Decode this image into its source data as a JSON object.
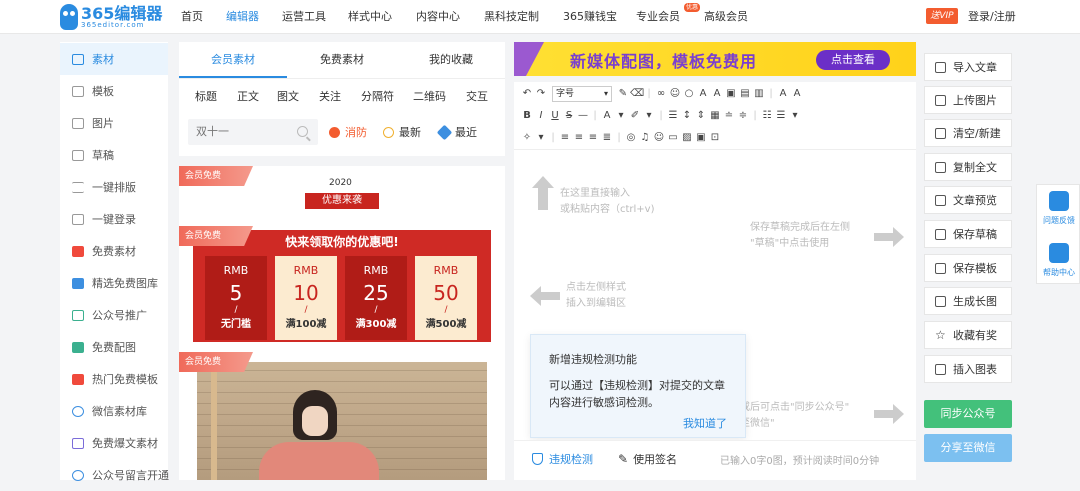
{
  "header": {
    "brand": "365编辑器",
    "domain": "365editor.com",
    "nav": [
      "首页",
      "编辑器",
      "运营工具",
      "样式中心",
      "内容中心",
      "黑科技定制",
      "365赚钱宝",
      "专业会员",
      "高级会员"
    ],
    "active_nav": "编辑器",
    "hot_badge": "优惠",
    "vip_badge": "送VIP",
    "login": "登录/注册"
  },
  "sidebar": {
    "items": [
      {
        "label": "素材",
        "icon": "folder-icon"
      },
      {
        "label": "模板",
        "icon": "template-icon"
      },
      {
        "label": "图片",
        "icon": "image-icon"
      },
      {
        "label": "草稿",
        "icon": "draft-icon"
      },
      {
        "label": "一键排版",
        "icon": "format-icon"
      },
      {
        "label": "一键登录",
        "icon": "login-icon"
      },
      {
        "label": "免费素材",
        "icon": "free-material-icon"
      },
      {
        "label": "精选免费图库",
        "icon": "gallery-icon"
      },
      {
        "label": "公众号推广",
        "icon": "book-icon"
      },
      {
        "label": "免费配图",
        "icon": "picture-icon"
      },
      {
        "label": "热门免费模板",
        "icon": "hot-template-icon"
      },
      {
        "label": "微信素材库",
        "icon": "wechat-library-icon"
      },
      {
        "label": "免费爆文素材",
        "icon": "article-icon"
      },
      {
        "label": "公众号留言开通",
        "icon": "comment-icon"
      }
    ]
  },
  "material_panel": {
    "tabs": [
      "会员素材",
      "免费素材",
      "我的收藏"
    ],
    "categories": [
      "标题",
      "正文",
      "图文",
      "关注",
      "分隔符",
      "二维码",
      "交互"
    ],
    "search_placeholder": "双十一",
    "filters": [
      "消防",
      "最新",
      "最近"
    ]
  },
  "material_list": {
    "badge": "会员免费",
    "card1": {
      "year": "2020",
      "title": "优惠来袭"
    },
    "card2": {
      "title": "快来领取你的优惠吧!",
      "coupons": [
        {
          "unit": "RMB",
          "value": "5",
          "slash": "/",
          "cond": "无门槛"
        },
        {
          "unit": "RMB",
          "value": "10",
          "slash": "/",
          "cond": "满100减"
        },
        {
          "unit": "RMB",
          "value": "25",
          "slash": "/",
          "cond": "满300减"
        },
        {
          "unit": "RMB",
          "value": "50",
          "slash": "/",
          "cond": "满500减"
        }
      ]
    }
  },
  "banner": {
    "text": "新媒体配图，模板免费用",
    "button": "点击查看"
  },
  "toolbar": {
    "font_select": "字号"
  },
  "editor": {
    "hint_input": "在这里直接输入\n或粘贴内容（ctrl+v)",
    "hint_style": "点击左侧样式\n插入到编辑区",
    "hint_draft": "保存草稿完成后在左侧\n\"草稿\"中点击使用",
    "hint_sync": "或后可点击\"同步公众号\"\n至微信\""
  },
  "popup": {
    "title": "新增违规检测功能",
    "body": "可以通过【违规检测】对提交的文章内容进行敏感词检测。",
    "button": "我知道了"
  },
  "footer": {
    "check": "违规检测",
    "signature": "使用签名",
    "status": "已输入0字0图，预计阅读时间0分钟"
  },
  "actions": {
    "items": [
      "导入文章",
      "上传图片",
      "清空/新建",
      "复制全文",
      "文章预览",
      "保存草稿",
      "保存模板",
      "生成长图",
      "收藏有奖",
      "插入图表"
    ],
    "sync": "同步公众号",
    "share": "分享至微信"
  },
  "float": {
    "feedback": "问题反馈",
    "help": "帮助中心"
  },
  "colors": {
    "accent": "#2a8be0",
    "red": "#c8251f",
    "green": "#43c17b",
    "light_blue": "#7cc0f0"
  }
}
